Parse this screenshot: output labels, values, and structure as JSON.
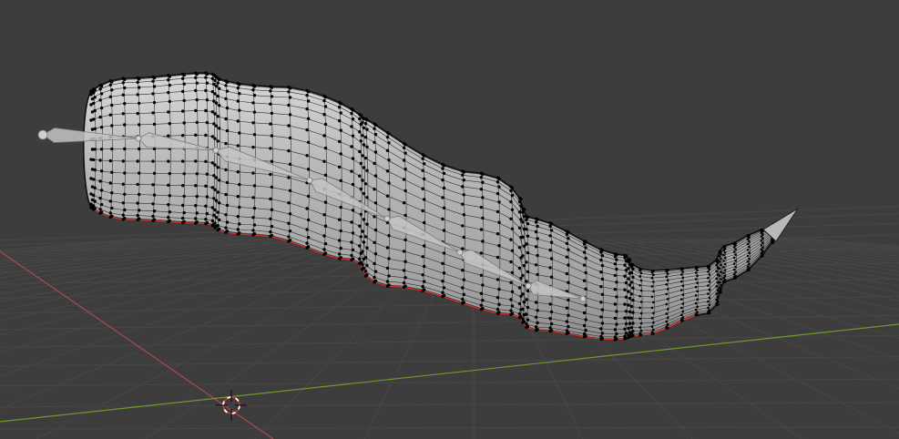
{
  "viewport": {
    "mode": "edit-mode",
    "background_color": "#3d3d3d",
    "floor_grid_color": "#474747",
    "x_axis_color": "#b0464f",
    "y_axis_color": "#6f9a2f",
    "mesh_fill_color": "#a9a9a9",
    "mesh_wire_color": "#2e2e2e",
    "vertex_color": "#000000",
    "seam_color": "#e0302a",
    "armature_color": "#c4c4c4",
    "cursor_colors": [
      "#ffffff",
      "#d42b2b"
    ],
    "icons": [
      "3d-cursor-icon"
    ]
  }
}
